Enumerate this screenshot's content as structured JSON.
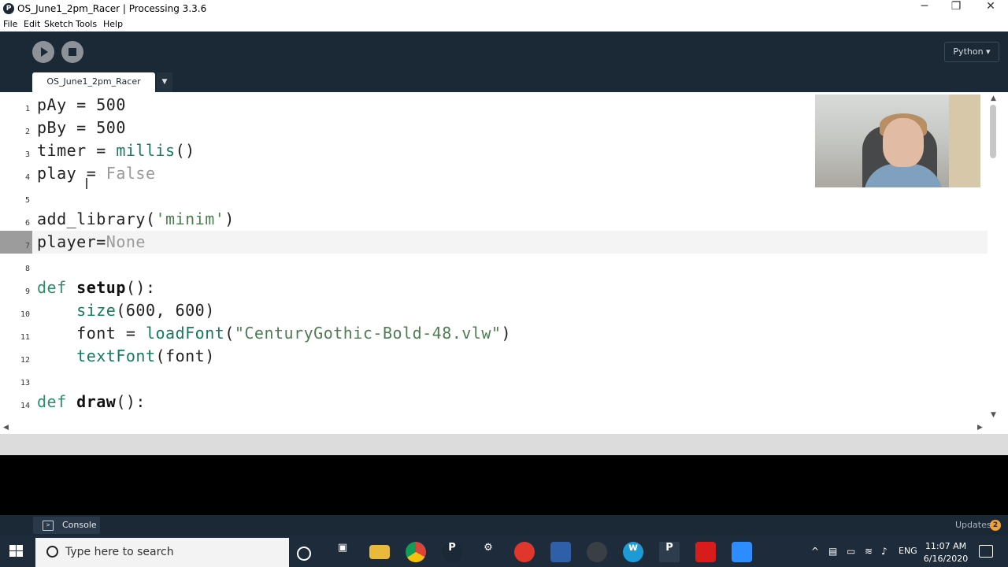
{
  "window": {
    "title": "OS_June1_2pm_Racer | Processing 3.3.6",
    "app_icon": "P",
    "controls": {
      "minimize": "─",
      "maximize": "❐",
      "close": "✕"
    }
  },
  "menu": [
    "File",
    "Edit",
    "Sketch",
    "Tools",
    "Help"
  ],
  "toolbar": {
    "run_icon": "play-icon",
    "stop_icon": "stop-icon",
    "mode": "Python ▾"
  },
  "tabs": [
    {
      "label": "OS_June1_2pm_Racer"
    }
  ],
  "tab_menu": "▼",
  "editor": {
    "current_line": 7,
    "lines": [
      {
        "n": "1",
        "text": "pAy = 500"
      },
      {
        "n": "2",
        "text": "pBy = 500"
      },
      {
        "n": "3",
        "text": "timer = millis()"
      },
      {
        "n": "4",
        "text": "play = False"
      },
      {
        "n": "5",
        "text": ""
      },
      {
        "n": "6",
        "text": "add_library('minim')"
      },
      {
        "n": "7",
        "text": "player=None"
      },
      {
        "n": "8",
        "text": ""
      },
      {
        "n": "9",
        "text": "def setup():"
      },
      {
        "n": "10",
        "text": "    size(600, 600)"
      },
      {
        "n": "11",
        "text": "    font = loadFont(\"CenturyGothic-Bold-48.vlw\")"
      },
      {
        "n": "12",
        "text": "    textFont(font)"
      },
      {
        "n": "13",
        "text": ""
      },
      {
        "n": "14",
        "text": "def draw():"
      }
    ]
  },
  "footer": {
    "console_label": "Console",
    "updates_label": "Updates",
    "updates_count": "2"
  },
  "taskbar": {
    "search_placeholder": "Type here to search",
    "language": "ENG",
    "time": "11:07 AM",
    "date": "6/16/2020",
    "apps": [
      "cortana-icon",
      "task-view-icon",
      "file-explorer-icon",
      "chrome-icon",
      "processing-icon",
      "settings-icon",
      "app-red-icon",
      "app-blue-icon",
      "app-gray-icon",
      "app-w-icon",
      "processing-active-icon",
      "acrobat-icon",
      "zoom-icon"
    ]
  },
  "colors": {
    "toolbar_bg": "#1b2836",
    "keyword": "#2b8f6a",
    "string": "#4e7d52",
    "constant": "#9a9a9a"
  }
}
